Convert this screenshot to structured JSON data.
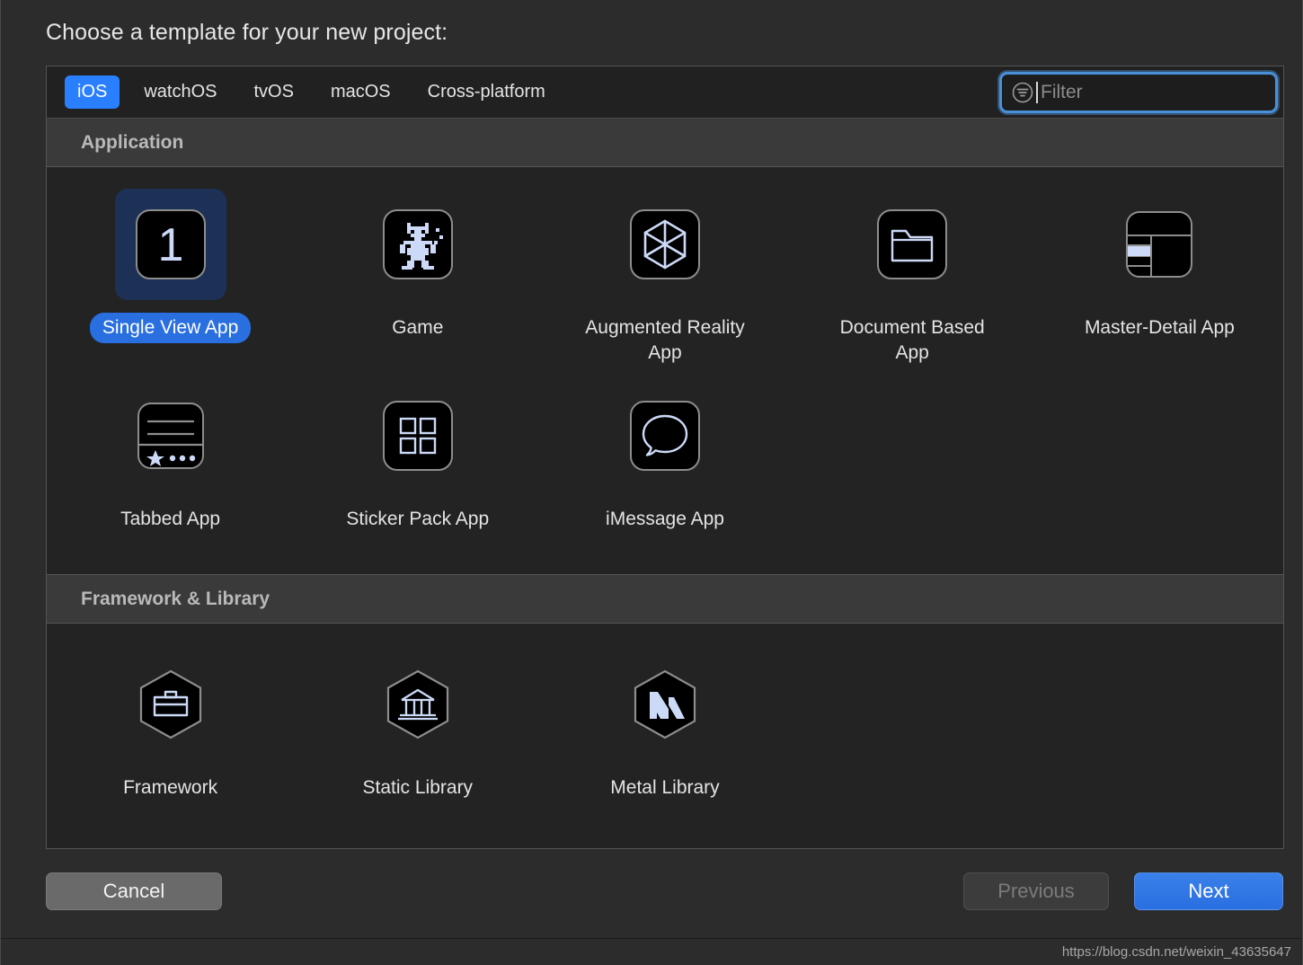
{
  "dialog": {
    "title": "Choose a template for your new project:"
  },
  "tabs": [
    {
      "label": "iOS",
      "selected": true
    },
    {
      "label": "watchOS",
      "selected": false
    },
    {
      "label": "tvOS",
      "selected": false
    },
    {
      "label": "macOS",
      "selected": false
    },
    {
      "label": "Cross-platform",
      "selected": false
    }
  ],
  "filter": {
    "placeholder": "Filter",
    "value": "",
    "icon": "filter-icon",
    "focused": true
  },
  "sections": [
    {
      "header": "Application",
      "items": [
        {
          "label": "Single View App",
          "icon": "number-one-icon",
          "selected": true
        },
        {
          "label": "Game",
          "icon": "spaceman-sprite-icon",
          "selected": false
        },
        {
          "label": "Augmented Reality App",
          "icon": "wireframe-cube-icon",
          "selected": false
        },
        {
          "label": "Document Based App",
          "icon": "folder-icon",
          "selected": false
        },
        {
          "label": "Master-Detail App",
          "icon": "split-layout-icon",
          "selected": false
        },
        {
          "label": "Tabbed App",
          "icon": "tab-bar-icon",
          "selected": false
        },
        {
          "label": "Sticker Pack App",
          "icon": "four-squares-grid-icon",
          "selected": false
        },
        {
          "label": "iMessage App",
          "icon": "speech-bubble-icon",
          "selected": false
        }
      ]
    },
    {
      "header": "Framework & Library",
      "items": [
        {
          "label": "Framework",
          "icon": "hexagon-toolbox-icon",
          "selected": false
        },
        {
          "label": "Static Library",
          "icon": "hexagon-bank-icon",
          "selected": false
        },
        {
          "label": "Metal Library",
          "icon": "hexagon-metal-m-icon",
          "selected": false
        }
      ]
    }
  ],
  "footer": {
    "cancel": "Cancel",
    "previous": "Previous",
    "next": "Next"
  },
  "watermark": "https://blog.csdn.net/weixin_43635647",
  "colors": {
    "accent_blue": "#2a7fff",
    "default_button_blue": "#2a6fe0",
    "selection_tile": "#1d3157",
    "icon_stroke": "#ccd9f7",
    "panel_bg": "#232323",
    "section_header_bg": "#3a3a3a"
  }
}
